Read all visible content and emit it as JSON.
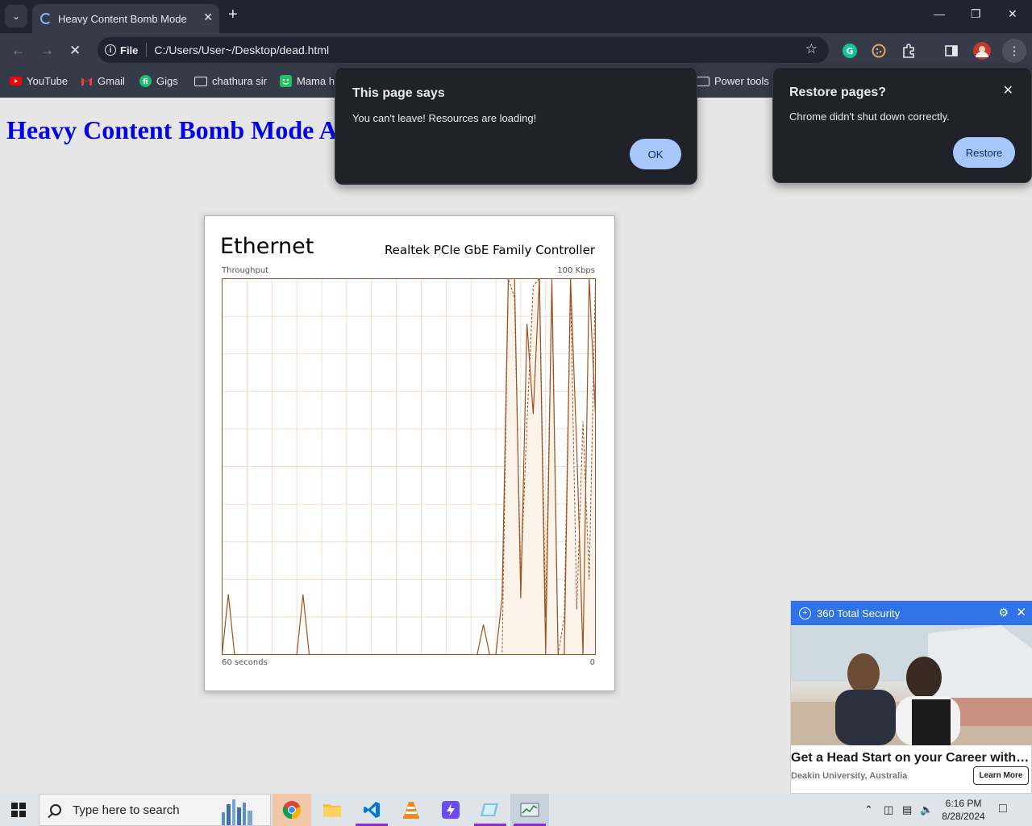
{
  "browser": {
    "tab_title": "Heavy Content Bomb Mode",
    "new_tab_symbol": "+",
    "address_scheme": "File",
    "address_url": "C:/Users/User~/Desktop/dead.html"
  },
  "bookmarks": [
    {
      "label": "YouTube",
      "icon": "youtube-icon"
    },
    {
      "label": "Gmail",
      "icon": "gmail-icon"
    },
    {
      "label": "Gigs",
      "icon": "fiverr-icon"
    },
    {
      "label": "chathura sir",
      "icon": "folder-icon"
    },
    {
      "label": "Mama ho",
      "icon": "mama-icon"
    },
    {
      "label": "Power tools",
      "icon": "folder-icon"
    }
  ],
  "page": {
    "heading": "Heavy Content Bomb Mode A"
  },
  "alert": {
    "title": "This page says",
    "message": "You can't leave! Resources are loading!",
    "ok_label": "OK"
  },
  "restore": {
    "title": "Restore pages?",
    "message": "Chrome didn't shut down correctly.",
    "button_label": "Restore"
  },
  "ethernet": {
    "title": "Ethernet",
    "adapter": "Realtek PCIe GbE Family Controller",
    "throughput_label": "Throughput",
    "max_label": "100 Kbps",
    "time_label": "60 seconds",
    "zero_label": "0",
    "line_color": "#a0501e",
    "fill_color": "#fcf3ea",
    "grid_color": "#f0dccb"
  },
  "chart_data": {
    "type": "line",
    "ylabel": "Throughput",
    "ylim": [
      0,
      100
    ],
    "x": [
      0,
      1,
      2,
      3,
      4,
      5,
      6,
      7,
      8,
      9,
      10,
      11,
      12,
      13,
      14,
      15,
      16,
      17,
      18,
      19,
      20,
      21,
      22,
      23,
      24,
      25,
      26,
      27,
      28,
      29,
      30,
      31,
      32,
      33,
      34,
      35,
      36,
      37,
      38,
      39,
      40,
      41,
      42,
      43,
      44,
      45,
      46,
      47,
      48,
      49,
      50,
      51,
      52,
      53,
      54,
      55,
      56,
      57,
      58,
      59,
      60
    ],
    "series": [
      {
        "values": [
          0,
          16,
          0,
          0,
          0,
          0,
          0,
          0,
          0,
          0,
          0,
          0,
          0,
          16,
          0,
          0,
          0,
          0,
          0,
          0,
          0,
          0,
          0,
          0,
          0,
          0,
          0,
          0,
          0,
          0,
          0,
          0,
          0,
          0,
          0,
          0,
          0,
          0,
          0,
          0,
          0,
          0,
          8,
          0,
          0,
          15,
          100,
          100,
          15,
          88,
          64,
          100,
          0,
          100,
          0,
          0,
          100,
          55,
          0,
          100,
          64
        ]
      },
      {
        "values": [
          0,
          0,
          0,
          0,
          0,
          0,
          0,
          0,
          0,
          0,
          0,
          0,
          0,
          0,
          0,
          0,
          0,
          0,
          0,
          0,
          0,
          0,
          0,
          0,
          0,
          0,
          0,
          0,
          0,
          0,
          0,
          0,
          0,
          0,
          0,
          0,
          0,
          0,
          0,
          0,
          0,
          0,
          0,
          0,
          0,
          0,
          100,
          95,
          20,
          62,
          98,
          100,
          10,
          98,
          0,
          10,
          98,
          12,
          62,
          20,
          100
        ]
      }
    ]
  },
  "ad": {
    "brand": "360 Total Security",
    "headline": "Get a Head Start on your Career with Deakin",
    "sub": "Deakin University, Australia",
    "button": "Learn More"
  },
  "taskbar": {
    "search_placeholder": "Type here to search",
    "time": "6:16 PM",
    "date": "8/28/2024"
  }
}
